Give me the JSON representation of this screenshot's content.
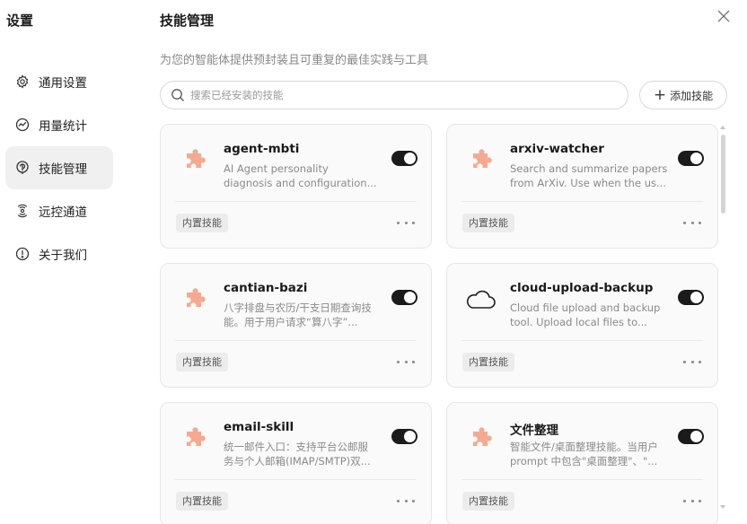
{
  "sidebar": {
    "title": "设置",
    "items": [
      {
        "label": "通用设置",
        "icon": "gear-icon"
      },
      {
        "label": "用量统计",
        "icon": "chart-line-icon"
      },
      {
        "label": "技能管理",
        "icon": "brain-icon",
        "active": true
      },
      {
        "label": "远控通道",
        "icon": "remote-icon"
      },
      {
        "label": "关于我们",
        "icon": "info-icon"
      }
    ]
  },
  "header": {
    "title": "技能管理",
    "subtitle": "为您的智能体提供预封装且可重复的最佳实践与工具"
  },
  "search": {
    "placeholder": "搜索已经安装的技能",
    "value": ""
  },
  "add_button": {
    "label": "添加技能"
  },
  "colors": {
    "accent": "#1b1b1b",
    "puzzle": "#f39a7c",
    "badge_bg": "#ececec"
  },
  "skills": [
    {
      "name": "agent-mbti",
      "desc1": "AI Agent personality",
      "desc2": "diagnosis and configuration...",
      "badge": "内置技能",
      "enabled": true,
      "icon": "puzzle-icon"
    },
    {
      "name": "arxiv-watcher",
      "desc1": "Search and summarize papers",
      "desc2": "from ArXiv. Use when the us...",
      "badge": "内置技能",
      "enabled": true,
      "icon": "puzzle-icon"
    },
    {
      "name": "cantian-bazi",
      "desc1": "八字排盘与农历/干支日期查询技",
      "desc2": "能。用于用户请求“算八字”...",
      "badge": "内置技能",
      "enabled": true,
      "icon": "puzzle-icon"
    },
    {
      "name": "cloud-upload-backup",
      "desc1": "Cloud file upload and backup",
      "desc2": "tool. Upload local files to...",
      "badge": "内置技能",
      "enabled": true,
      "icon": "cloud-icon"
    },
    {
      "name": "email-skill",
      "desc1": "统一邮件入口：支持平台公邮服",
      "desc2": "务与个人邮箱(IMAP/SMTP)双...",
      "badge": "内置技能",
      "enabled": true,
      "icon": "puzzle-icon"
    },
    {
      "name": "文件整理",
      "desc1": "智能文件/桌面整理技能。当用户",
      "desc2": "prompt 中包含\"桌面整理\"、\"...",
      "badge": "内置技能",
      "enabled": true,
      "icon": "puzzle-icon"
    }
  ]
}
